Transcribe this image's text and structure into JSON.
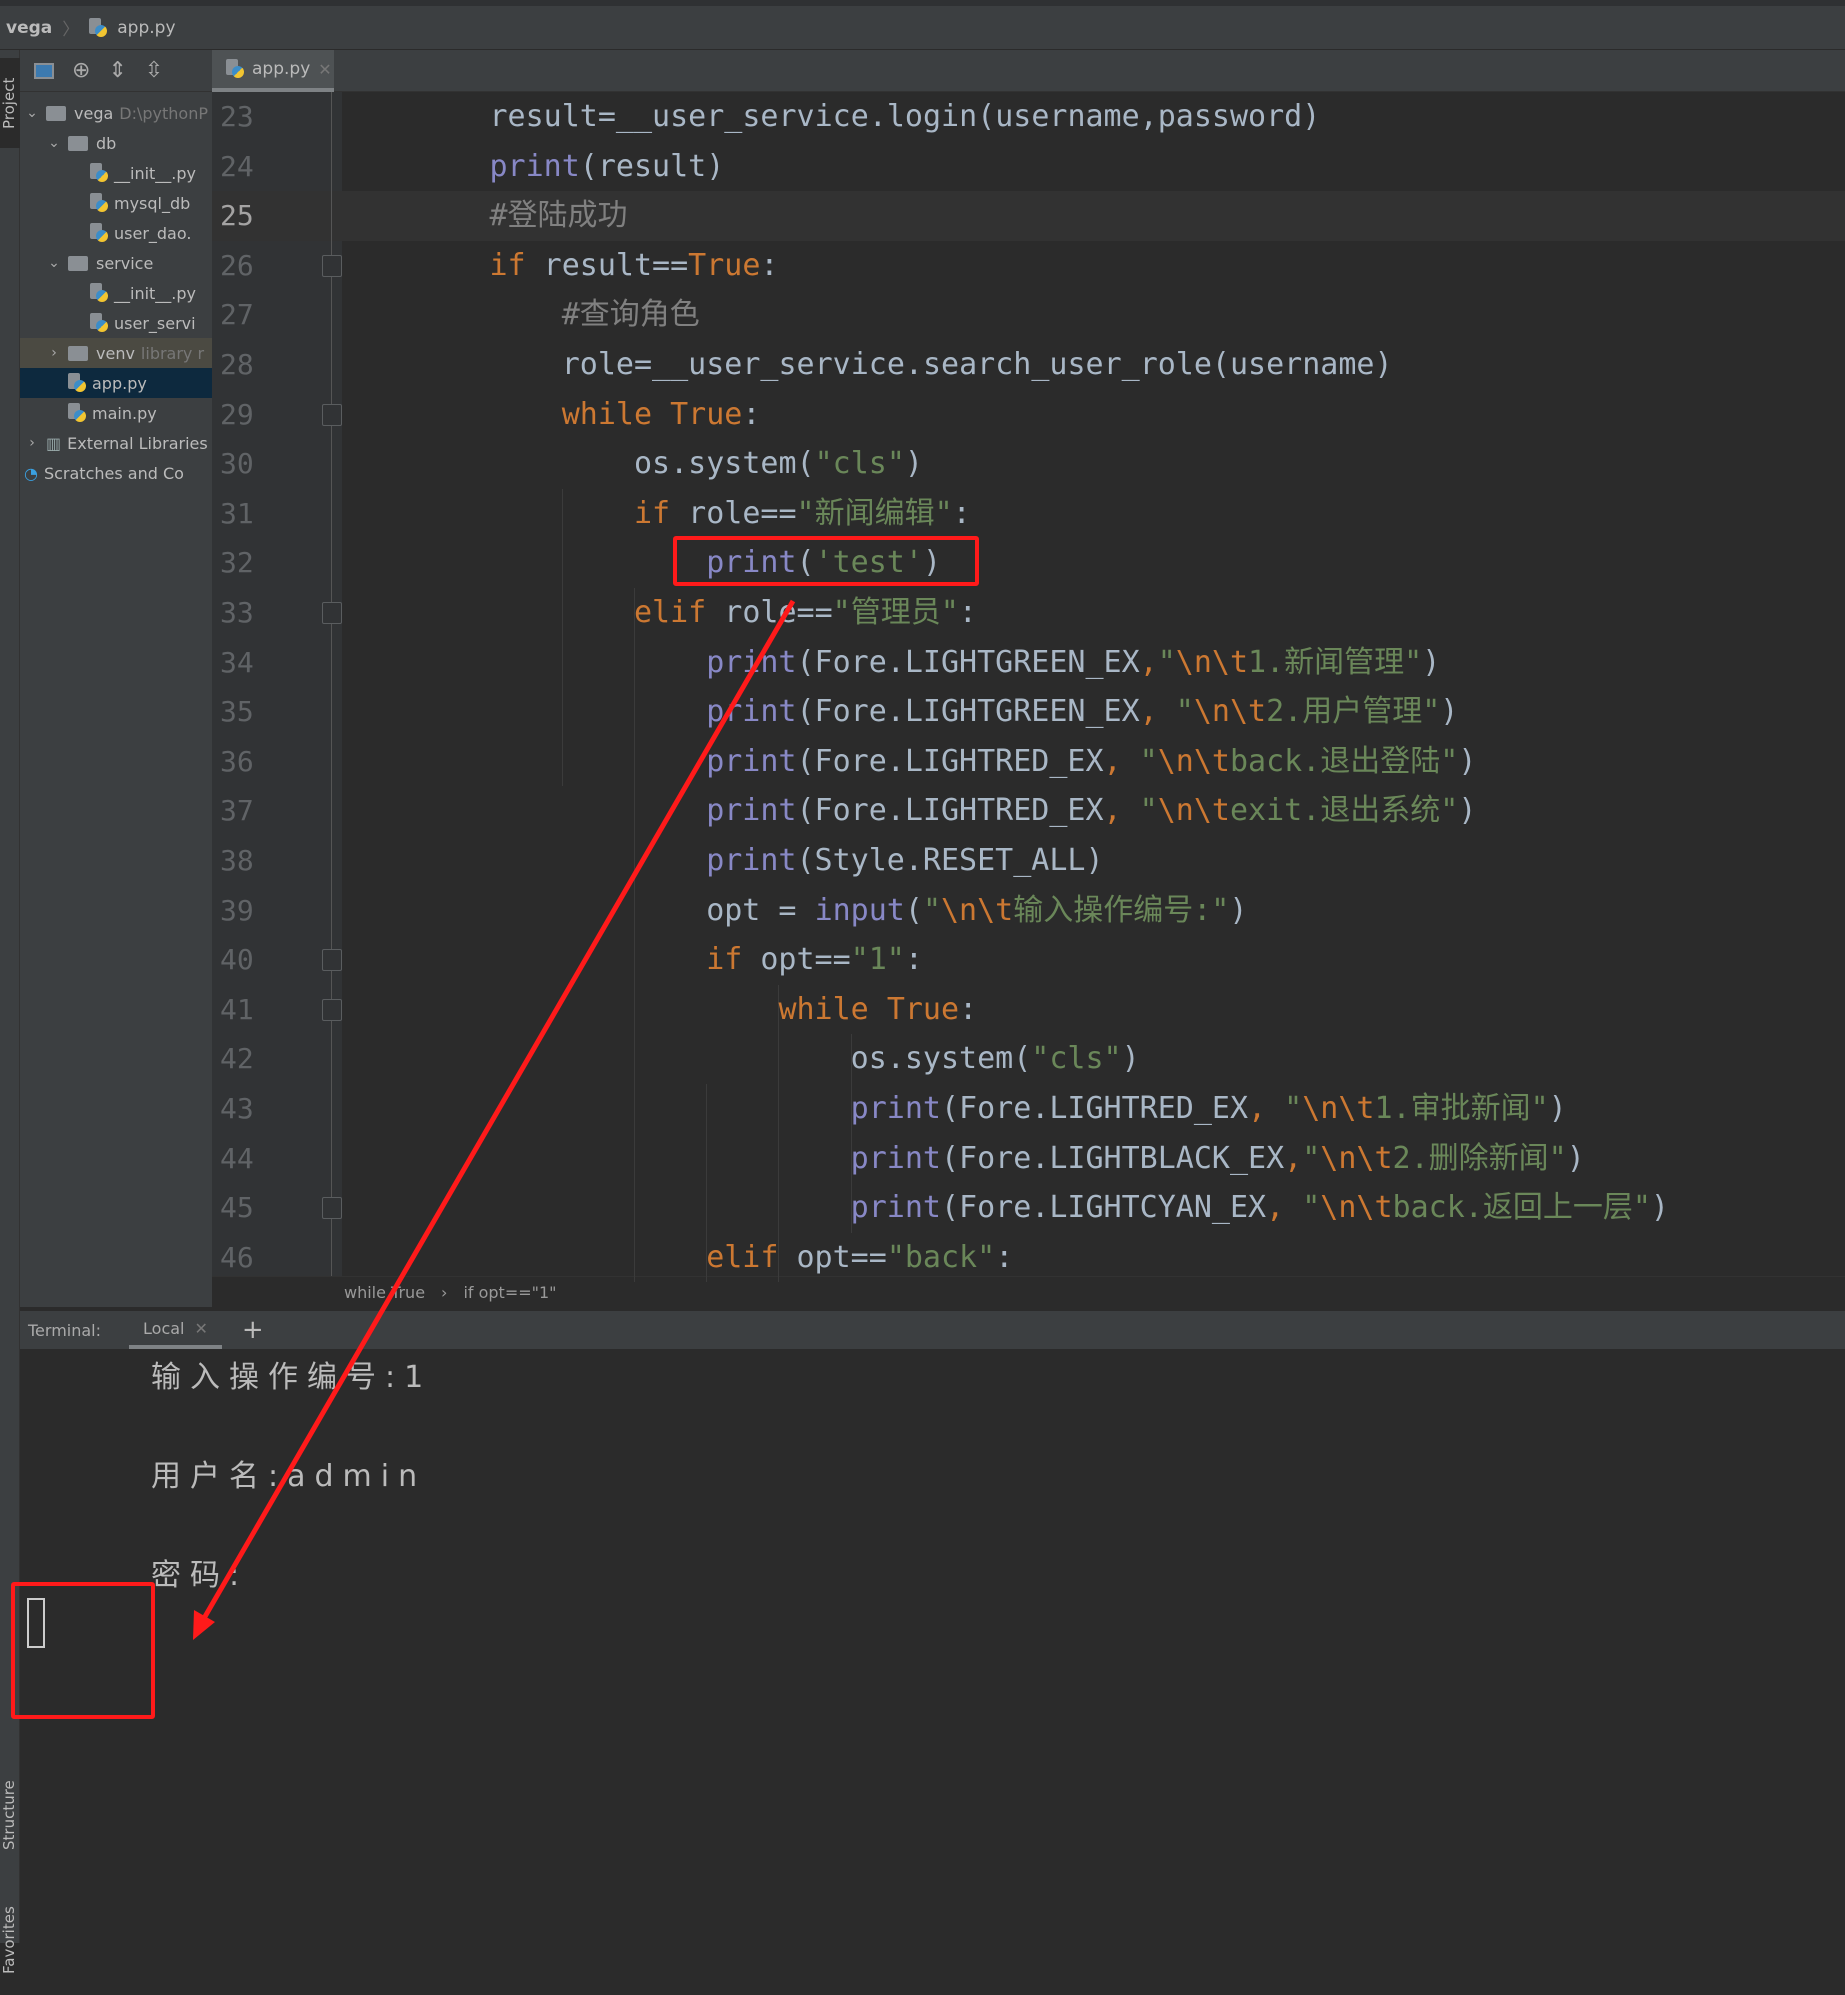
{
  "breadcrumb": {
    "project": "vega",
    "file": "app.py"
  },
  "sidebar": {
    "tab_project": "Project",
    "tab_structure": "Structure",
    "tab_favorites": "Favorites"
  },
  "project_tree": [
    {
      "label": "vega",
      "hint": "D:\\pythonP",
      "type": "folder",
      "depth": 0,
      "expanded": true
    },
    {
      "label": "db",
      "type": "folder",
      "depth": 1,
      "expanded": true
    },
    {
      "label": "__init__.py",
      "type": "py",
      "depth": 3
    },
    {
      "label": "mysql_db",
      "type": "py",
      "depth": 3
    },
    {
      "label": "user_dao.",
      "type": "py",
      "depth": 3
    },
    {
      "label": "service",
      "type": "folder",
      "depth": 1,
      "expanded": true
    },
    {
      "label": "__init__.py",
      "type": "py",
      "depth": 3
    },
    {
      "label": "user_servi",
      "type": "py",
      "depth": 3
    },
    {
      "label": "venv",
      "hint": "library r",
      "type": "folder",
      "depth": 1,
      "expanded": false,
      "state": "venv"
    },
    {
      "label": "app.py",
      "type": "py",
      "depth": 2,
      "state": "selected"
    },
    {
      "label": "main.py",
      "type": "py",
      "depth": 2
    },
    {
      "label": "External Libraries",
      "type": "lib",
      "depth": 0,
      "expanded": false
    },
    {
      "label": "Scratches and Co",
      "type": "scratch",
      "depth": 0
    }
  ],
  "editor": {
    "tab": "app.py",
    "current_line": 25,
    "lines": [
      {
        "n": 23,
        "indent": 8,
        "tokens": [
          [
            "plain",
            "result=__user_service.login(username,password)"
          ]
        ]
      },
      {
        "n": 24,
        "indent": 8,
        "tokens": [
          [
            "bi",
            "print"
          ],
          [
            "plain",
            "(result)"
          ]
        ]
      },
      {
        "n": 25,
        "indent": 8,
        "tokens": [
          [
            "cm",
            "#登陆成功"
          ]
        ]
      },
      {
        "n": 26,
        "indent": 8,
        "fold": true,
        "tokens": [
          [
            "kw",
            "if"
          ],
          [
            "plain",
            " result=="
          ],
          [
            "kw",
            "True"
          ],
          [
            "plain",
            ":"
          ]
        ]
      },
      {
        "n": 27,
        "indent": 12,
        "tokens": [
          [
            "cm",
            "#查询角色"
          ]
        ]
      },
      {
        "n": 28,
        "indent": 12,
        "tokens": [
          [
            "plain",
            "role=__user_service.search_user_role(username)"
          ]
        ]
      },
      {
        "n": 29,
        "indent": 12,
        "fold": true,
        "tokens": [
          [
            "kw",
            "while "
          ],
          [
            "kw",
            "True"
          ],
          [
            "plain",
            ":"
          ]
        ]
      },
      {
        "n": 30,
        "indent": 16,
        "tokens": [
          [
            "plain",
            "os.system("
          ],
          [
            "str",
            "\"cls\""
          ],
          [
            "plain",
            ")"
          ]
        ]
      },
      {
        "n": 31,
        "indent": 16,
        "tokens": [
          [
            "kw",
            "if"
          ],
          [
            "plain",
            " role=="
          ],
          [
            "str",
            "\"新闻编辑\""
          ],
          [
            "plain",
            ":"
          ]
        ]
      },
      {
        "n": 32,
        "indent": 20,
        "tokens": [
          [
            "bi",
            "print"
          ],
          [
            "plain",
            "("
          ],
          [
            "str",
            "'test'"
          ],
          [
            "plain",
            ")"
          ]
        ]
      },
      {
        "n": 33,
        "indent": 16,
        "fold": true,
        "tokens": [
          [
            "kw",
            "elif"
          ],
          [
            "plain",
            " role=="
          ],
          [
            "str",
            "\"管理员\""
          ],
          [
            "plain",
            ":"
          ]
        ]
      },
      {
        "n": 34,
        "indent": 20,
        "tokens": [
          [
            "bi",
            "print"
          ],
          [
            "plain",
            "(Fore.LIGHTGREEN_EX"
          ],
          [
            "kw",
            ","
          ],
          [
            "str",
            "\""
          ],
          [
            "esc",
            "\\n\\t"
          ],
          [
            "str",
            "1.新闻管理\""
          ],
          [
            "plain",
            ")"
          ]
        ]
      },
      {
        "n": 35,
        "indent": 20,
        "tokens": [
          [
            "bi",
            "print"
          ],
          [
            "plain",
            "(Fore.LIGHTGREEN_EX"
          ],
          [
            "kw",
            ", "
          ],
          [
            "str",
            "\""
          ],
          [
            "esc",
            "\\n\\t"
          ],
          [
            "str",
            "2.用户管理\""
          ],
          [
            "plain",
            ")"
          ]
        ]
      },
      {
        "n": 36,
        "indent": 20,
        "tokens": [
          [
            "bi",
            "print"
          ],
          [
            "plain",
            "(Fore.LIGHTRED_EX"
          ],
          [
            "kw",
            ", "
          ],
          [
            "str",
            "\""
          ],
          [
            "esc",
            "\\n\\t"
          ],
          [
            "str",
            "back.退出登陆\""
          ],
          [
            "plain",
            ")"
          ]
        ]
      },
      {
        "n": 37,
        "indent": 20,
        "tokens": [
          [
            "bi",
            "print"
          ],
          [
            "plain",
            "(Fore.LIGHTRED_EX"
          ],
          [
            "kw",
            ", "
          ],
          [
            "str",
            "\""
          ],
          [
            "esc",
            "\\n\\t"
          ],
          [
            "str",
            "exit.退出系统\""
          ],
          [
            "plain",
            ")"
          ]
        ]
      },
      {
        "n": 38,
        "indent": 20,
        "tokens": [
          [
            "bi",
            "print"
          ],
          [
            "plain",
            "(Style.RESET_ALL)"
          ]
        ]
      },
      {
        "n": 39,
        "indent": 20,
        "tokens": [
          [
            "plain",
            "opt = "
          ],
          [
            "bi",
            "input"
          ],
          [
            "plain",
            "("
          ],
          [
            "str",
            "\""
          ],
          [
            "esc",
            "\\n\\t"
          ],
          [
            "str",
            "输入操作编号:\""
          ],
          [
            "plain",
            ")"
          ]
        ]
      },
      {
        "n": 40,
        "indent": 20,
        "fold": true,
        "tokens": [
          [
            "kw",
            "if"
          ],
          [
            "plain",
            " opt=="
          ],
          [
            "str",
            "\"1\""
          ],
          [
            "plain",
            ":"
          ]
        ]
      },
      {
        "n": 41,
        "indent": 24,
        "fold": true,
        "tokens": [
          [
            "kw",
            "while "
          ],
          [
            "kw",
            "True"
          ],
          [
            "plain",
            ":"
          ]
        ]
      },
      {
        "n": 42,
        "indent": 28,
        "tokens": [
          [
            "plain",
            "os.system("
          ],
          [
            "str",
            "\"cls\""
          ],
          [
            "plain",
            ")"
          ]
        ]
      },
      {
        "n": 43,
        "indent": 28,
        "tokens": [
          [
            "bi",
            "print"
          ],
          [
            "plain",
            "(Fore.LIGHTRED_EX"
          ],
          [
            "kw",
            ", "
          ],
          [
            "str",
            "\""
          ],
          [
            "esc",
            "\\n\\t"
          ],
          [
            "str",
            "1.审批新闻\""
          ],
          [
            "plain",
            ")"
          ]
        ]
      },
      {
        "n": 44,
        "indent": 28,
        "tokens": [
          [
            "bi",
            "print"
          ],
          [
            "plain",
            "(Fore.LIGHTBLACK_EX"
          ],
          [
            "kw",
            ","
          ],
          [
            "str",
            "\""
          ],
          [
            "esc",
            "\\n\\t"
          ],
          [
            "str",
            "2.删除新闻\""
          ],
          [
            "plain",
            ")"
          ]
        ]
      },
      {
        "n": 45,
        "indent": 28,
        "fold": true,
        "tokens": [
          [
            "bi",
            "print"
          ],
          [
            "plain",
            "(Fore.LIGHTCYAN_EX"
          ],
          [
            "kw",
            ", "
          ],
          [
            "str",
            "\""
          ],
          [
            "esc",
            "\\n\\t"
          ],
          [
            "str",
            "back.返回上一层\""
          ],
          [
            "plain",
            ")"
          ]
        ]
      },
      {
        "n": 46,
        "indent": 20,
        "tokens": [
          [
            "kw",
            "elif"
          ],
          [
            "plain",
            " opt=="
          ],
          [
            "str",
            "\"back\""
          ],
          [
            "plain",
            ":"
          ]
        ]
      }
    ],
    "crumbs": [
      "while True",
      "if opt==\"1\""
    ]
  },
  "terminal": {
    "label": "Terminal:",
    "tab": "Local",
    "add": "+",
    "lines": [
      "输入操作编号:1",
      "用户名:admin",
      "密码:"
    ]
  },
  "colors": {
    "keyword": "#cc7832",
    "string": "#6a8759",
    "builtin": "#8888c6",
    "comment": "#808080",
    "text": "#a9b7c6",
    "annotation": "#ff1a1a"
  }
}
